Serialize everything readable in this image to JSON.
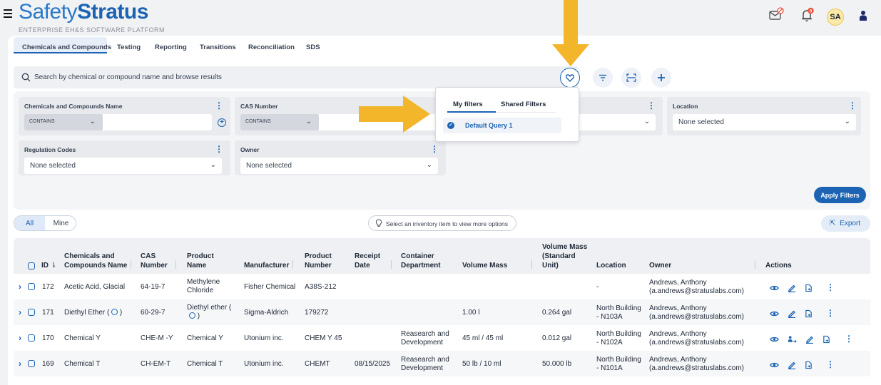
{
  "brand": {
    "name_part1": "Safety",
    "name_part2": "Stratus",
    "tagline": "ENTERPRISE EH&S SOFTWARE PLATFORM"
  },
  "user": {
    "initials": "SA",
    "notification_count": "0"
  },
  "colors": {
    "primary": "#1c64b3",
    "arrow": "#f3b62a",
    "badge": "#e8523a",
    "avatar_bg": "#fde9a8"
  },
  "tabs": [
    {
      "label": "Chemicals and Compounds",
      "active": true
    },
    {
      "label": "Testing"
    },
    {
      "label": "Reporting"
    },
    {
      "label": "Transitions"
    },
    {
      "label": "Reconciliation"
    },
    {
      "label": "SDS"
    }
  ],
  "search": {
    "placeholder": "Search by chemical or compound name and browse results"
  },
  "filters": {
    "chem_name": {
      "label": "Chemicals and Compounds Name",
      "operator": "CONTAINS"
    },
    "cas": {
      "label": "CAS Number",
      "operator": "CONTAINS"
    },
    "location": {
      "label": "Location",
      "value": "None selected"
    },
    "regulation": {
      "label": "Regulation Codes",
      "value": "None selected"
    },
    "owner": {
      "label": "Owner",
      "value": "None selected"
    },
    "apply_label": "Apply Filters"
  },
  "dropdown": {
    "tab_my": "My filters",
    "tab_shared": "Shared Filters",
    "item": "Default Query 1"
  },
  "toolbar": {
    "all": "All",
    "mine": "Mine",
    "hint": "Select an inventory item to view more options",
    "export": "Export"
  },
  "table": {
    "columns": {
      "id": "ID",
      "name": "Chemicals and Compounds Name",
      "cas": "CAS Number",
      "product_name": "Product Name",
      "manufacturer": "Manufacturer",
      "product_number": "Product Number",
      "receipt_date": "Receipt Date",
      "container_dept": "Container Department",
      "volume_mass": "Volume Mass",
      "vm_std": "Volume Mass (Standard Unit)",
      "location": "Location",
      "owner": "Owner",
      "actions": "Actions"
    },
    "rows": [
      {
        "id": "172",
        "name": "Acetic Acid, Glacial",
        "cas": "64-19-7",
        "product_name": "Methylene Chloride",
        "manufacturer": "Fisher Chemical",
        "product_number": "A38S-212",
        "receipt_date": "",
        "container_dept": "",
        "volume_mass": "",
        "vm_std": "",
        "location": "-",
        "owner": "Andrews, Anthony (a.andrews@stratuslabs.com)"
      },
      {
        "id": "171",
        "name": "Diethyl Ether (",
        "name_end": ")",
        "cas": "60-29-7",
        "product_name": "Diethyl ether (",
        "product_name_end": ")",
        "manufacturer": "Sigma-Aldrich",
        "product_number": "179272",
        "receipt_date": "",
        "container_dept": "",
        "volume_mass": "1.00 l",
        "vm_std": "0.264 gal",
        "location": "North Building - N103A",
        "owner": "Andrews, Anthony (a.andrews@stratuslabs.com)"
      },
      {
        "id": "170",
        "name": "Chemical Y",
        "cas": "CHE-M -Y",
        "product_name": "Chemical Y",
        "manufacturer": "Utonium inc.",
        "product_number": "CHEM Y 45",
        "receipt_date": "",
        "container_dept": "Reasearch and Development",
        "volume_mass": "45 ml / 45 ml",
        "vm_std": "0.012 gal",
        "location": "North Building - N102A",
        "owner": "Andrews, Anthony (a.andrews@stratuslabs.com)"
      },
      {
        "id": "169",
        "name": "Chemical T",
        "cas": "CH-EM-T",
        "product_name": "Chemical T",
        "manufacturer": "Utonium inc.",
        "product_number": "CHEMT",
        "receipt_date": "08/15/2025",
        "container_dept": "Reasearch and Development",
        "volume_mass": "50 lb / 10 ml",
        "vm_std": "50.000 lb",
        "location": "North Building - N101A",
        "owner": "Andrews, Anthony (a.andrews@stratuslabs.com)"
      }
    ]
  }
}
